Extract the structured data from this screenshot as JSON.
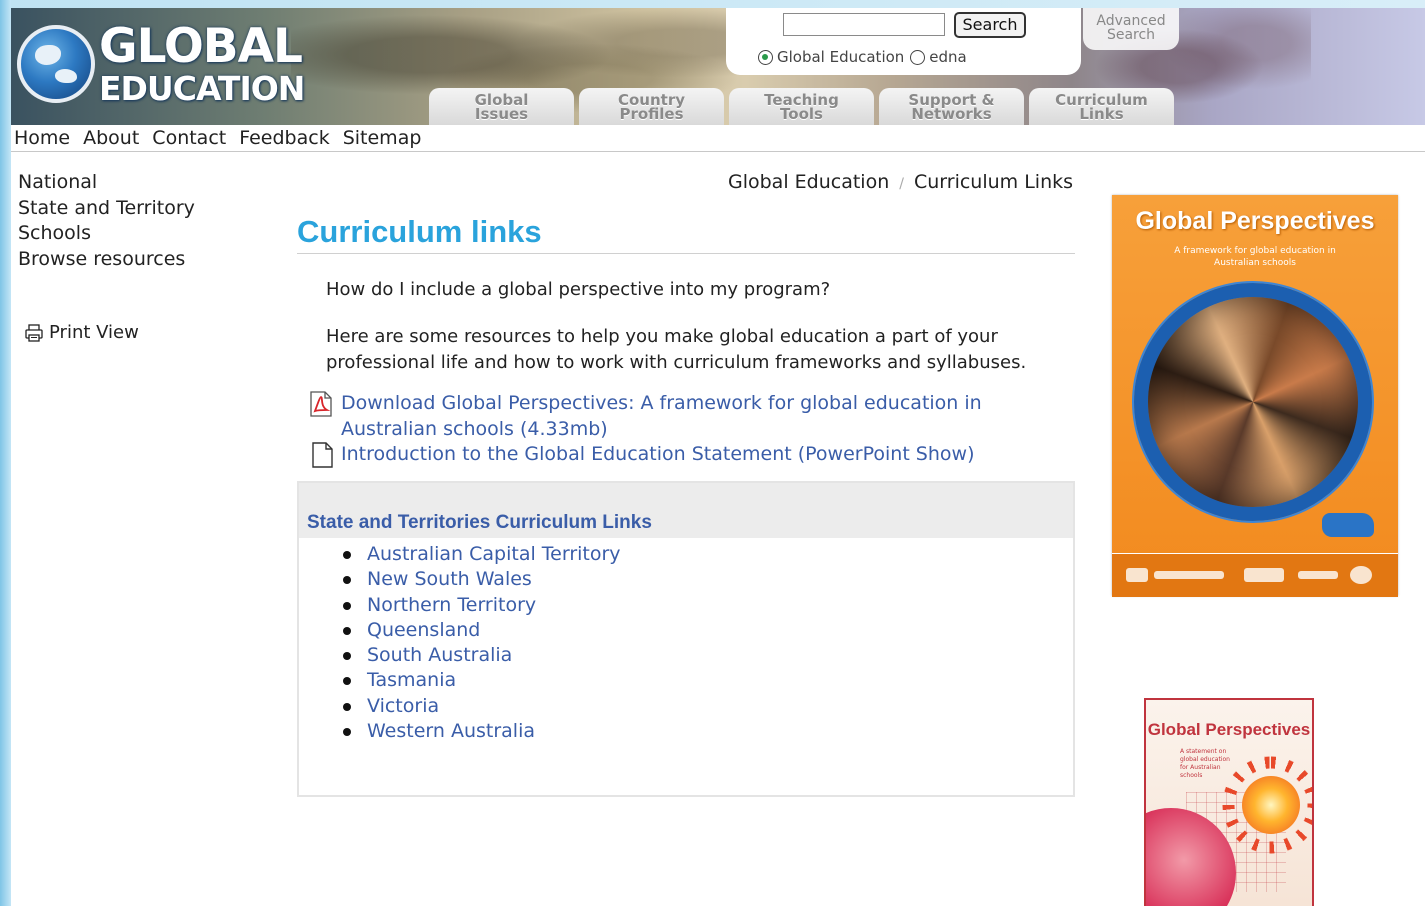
{
  "header": {
    "logo_line1": "GLOBAL",
    "logo_line2": "EDUCATION",
    "search": {
      "input_value": "",
      "button_label": "Search",
      "radio_options": [
        {
          "label": "Global Education",
          "checked": true
        },
        {
          "label": "edna",
          "checked": false
        }
      ]
    },
    "advanced_search_line1": "Advanced",
    "advanced_search_line2": "Search",
    "tabs": [
      {
        "line1": "Global",
        "line2": "Issues"
      },
      {
        "line1": "Country",
        "line2": "Profiles"
      },
      {
        "line1": "Teaching",
        "line2": "Tools"
      },
      {
        "line1": "Support &",
        "line2": "Networks"
      },
      {
        "line1": "Curriculum",
        "line2": "Links"
      }
    ]
  },
  "topnav": [
    "Home",
    "About",
    "Contact",
    "Feedback",
    "Sitemap"
  ],
  "sidebar": {
    "items": [
      "National",
      "State and Territory",
      "Schools",
      "Browse resources"
    ],
    "print_view": "Print View"
  },
  "breadcrumb": [
    "Global Education",
    "Curriculum Links"
  ],
  "main": {
    "title": "Curriculum links",
    "question": "How do I include a global perspective into my program?",
    "intro": "Here are some resources to help you make global education a part of your professional life and how to work with curriculum frameworks and syllabuses.",
    "downloads": [
      {
        "label": "Download Global Perspectives: A framework for global education in Australian schools (4.33mb)",
        "icon": "pdf-icon"
      },
      {
        "label": "Introduction to the Global Education Statement (PowerPoint Show)",
        "icon": "document-icon"
      }
    ],
    "curriculum_box": {
      "title": "State and Territories Curriculum Links",
      "links": [
        "Australian Capital Territory",
        "New South Wales",
        "Northern Territory",
        "Queensland",
        "South Australia",
        "Tasmania",
        "Victoria",
        "Western Australia"
      ]
    }
  },
  "sidebar_right": {
    "cover1_title": "Global Perspectives",
    "cover1_subtitle": "A framework for global education in Australian schools",
    "cover2_title": "Global Perspectives",
    "cover2_subtitle": "A statement on global education for Australian schools"
  },
  "colors": {
    "title_blue": "#2aa3dc",
    "link_blue": "#3a5da8",
    "cover_orange": "#f28a1e",
    "cover_red": "#c0343e"
  }
}
